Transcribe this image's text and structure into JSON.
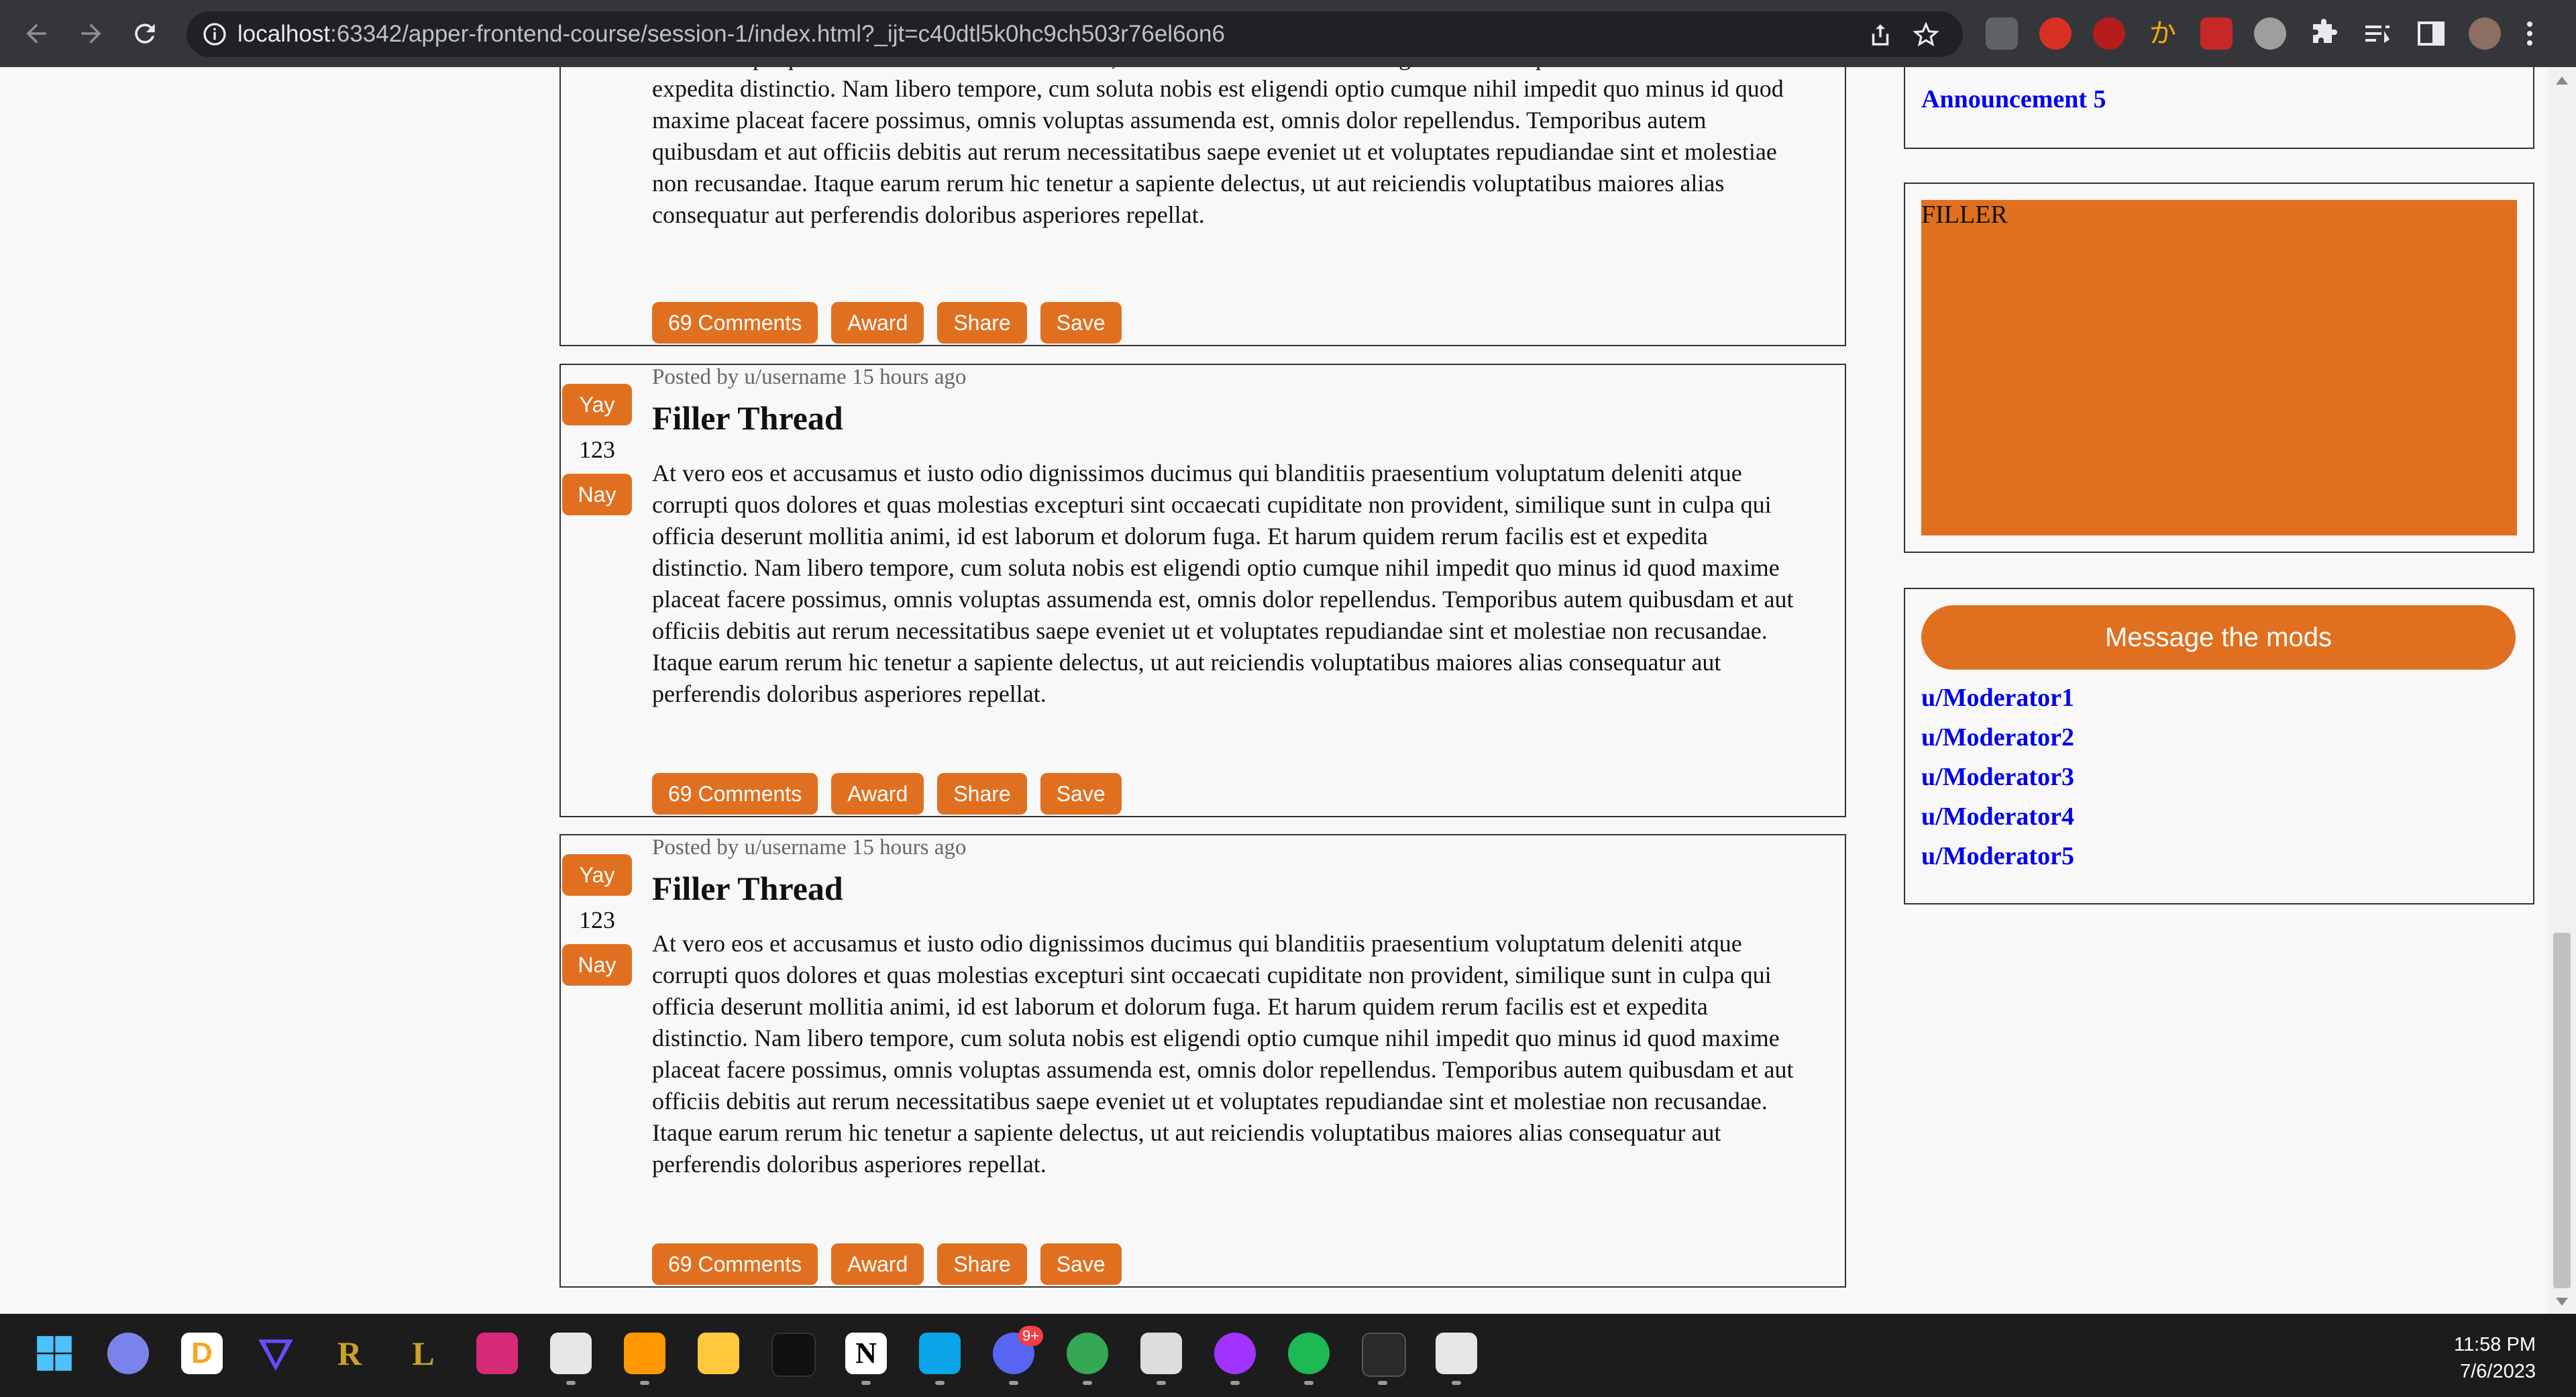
{
  "browser": {
    "url_host": "localhost",
    "url_rest": ":63342/apper-frontend-course/session-1/index.html?_ijt=c40dtl5k0hc9ch503r76el6on6"
  },
  "top_post_tail": {
    "body": "sunt in culpa qui officia deserunt mollitia animi, id est laborum et dolorum fuga. Et harum quidem rerum facilis est et expedita distinctio. Nam libero tempore, cum soluta nobis est eligendi optio cumque nihil impedit quo minus id quod maxime placeat facere possimus, omnis voluptas assumenda est, omnis dolor repellendus. Temporibus autem quibusdam et aut officiis debitis aut rerum necessitatibus saepe eveniet ut et voluptates repudiandae sint et molestiae non recusandae. Itaque earum rerum hic tenetur a sapiente delectus, ut aut reiciendis voluptatibus maiores alias consequatur aut perferendis doloribus asperiores repellat.",
    "comments": "69 Comments",
    "award": "Award",
    "share": "Share",
    "save": "Save"
  },
  "posts": [
    {
      "yay": "Yay",
      "count": "123",
      "nay": "Nay",
      "meta": "Posted by u/username 15 hours ago",
      "title": "Filler Thread",
      "body": "At vero eos et accusamus et iusto odio dignissimos ducimus qui blanditiis praesentium voluptatum deleniti atque corrupti quos dolores et quas molestias excepturi sint occaecati cupiditate non provident, similique sunt in culpa qui officia deserunt mollitia animi, id est laborum et dolorum fuga. Et harum quidem rerum facilis est et expedita distinctio. Nam libero tempore, cum soluta nobis est eligendi optio cumque nihil impedit quo minus id quod maxime placeat facere possimus, omnis voluptas assumenda est, omnis dolor repellendus. Temporibus autem quibusdam et aut officiis debitis aut rerum necessitatibus saepe eveniet ut et voluptates repudiandae sint et molestiae non recusandae. Itaque earum rerum hic tenetur a sapiente delectus, ut aut reiciendis voluptatibus maiores alias consequatur aut perferendis doloribus asperiores repellat.",
      "comments": "69 Comments",
      "award": "Award",
      "share": "Share",
      "save": "Save"
    },
    {
      "yay": "Yay",
      "count": "123",
      "nay": "Nay",
      "meta": "Posted by u/username 15 hours ago",
      "title": "Filler Thread",
      "body": "At vero eos et accusamus et iusto odio dignissimos ducimus qui blanditiis praesentium voluptatum deleniti atque corrupti quos dolores et quas molestias excepturi sint occaecati cupiditate non provident, similique sunt in culpa qui officia deserunt mollitia animi, id est laborum et dolorum fuga. Et harum quidem rerum facilis est et expedita distinctio. Nam libero tempore, cum soluta nobis est eligendi optio cumque nihil impedit quo minus id quod maxime placeat facere possimus, omnis voluptas assumenda est, omnis dolor repellendus. Temporibus autem quibusdam et aut officiis debitis aut rerum necessitatibus saepe eveniet ut et voluptates repudiandae sint et molestiae non recusandae. Itaque earum rerum hic tenetur a sapiente delectus, ut aut reiciendis voluptatibus maiores alias consequatur aut perferendis doloribus asperiores repellat.",
      "comments": "69 Comments",
      "award": "Award",
      "share": "Share",
      "save": "Save"
    }
  ],
  "sidebar": {
    "announcement_last": "Announcement 5",
    "filler": "FILLER",
    "message_mods": "Message the mods",
    "moderators": [
      "u/Moderator1",
      "u/Moderator2",
      "u/Moderator3",
      "u/Moderator4",
      "u/Moderator5"
    ]
  },
  "taskbar": {
    "time": "11:58 PM",
    "date": "7/6/2023",
    "discord_badge": "9+"
  },
  "colors": {
    "accent": "#e07020",
    "link": "#0000ee",
    "chrome_bg": "#35363a",
    "taskbar_bg": "#1c1c1c"
  }
}
